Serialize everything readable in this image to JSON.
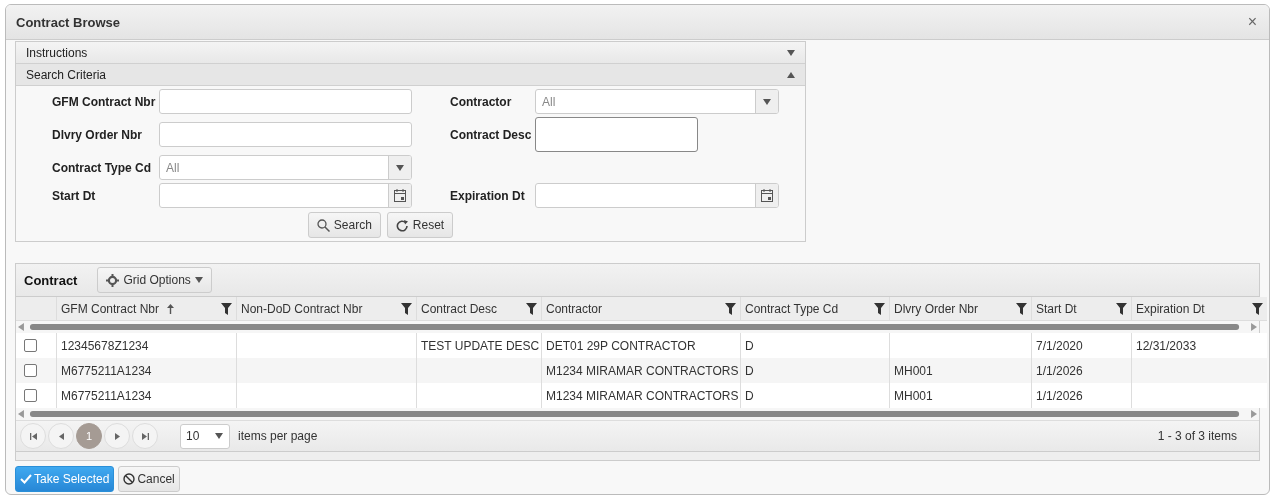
{
  "window": {
    "title": "Contract Browse",
    "close": "×"
  },
  "sections": [
    {
      "title": "Instructions",
      "expanded": false
    },
    {
      "title": "Search Criteria",
      "expanded": true
    }
  ],
  "form_rows": [
    {
      "left": {
        "label": "GFM Contract Nbr",
        "kind": "text"
      },
      "right": {
        "label": "Contractor",
        "kind": "select",
        "value": "All"
      }
    },
    {
      "left": {
        "label": "Dlvry Order Nbr",
        "kind": "text"
      },
      "right": {
        "label": "Contract Desc",
        "kind": "textarea"
      }
    },
    {
      "left": {
        "label": "Contract Type Cd",
        "kind": "select",
        "value": "All"
      }
    },
    {
      "left": {
        "label": "Start Dt",
        "kind": "date"
      },
      "right": {
        "label": "Expiration Dt",
        "kind": "date"
      }
    }
  ],
  "search_buttons": [
    {
      "label": "Search",
      "kind": "search"
    },
    {
      "label": "Reset",
      "kind": "reset"
    }
  ],
  "grid": {
    "title": "Contract",
    "options_label": "Grid Options",
    "columns": [
      {
        "label": "GFM Contract Nbr",
        "sorted": true
      },
      {
        "label": "Non-DoD Contract Nbr",
        "sorted": false
      },
      {
        "label": "Contract Desc",
        "sorted": false
      },
      {
        "label": "Contractor",
        "sorted": false
      },
      {
        "label": "Contract Type Cd",
        "sorted": false
      },
      {
        "label": "Dlvry Order Nbr",
        "sorted": false
      },
      {
        "label": "Start Dt",
        "sorted": false
      },
      {
        "label": "Expiration Dt",
        "sorted": false
      }
    ],
    "rows": [
      {
        "checked": false,
        "cells": [
          "12345678Z1234",
          "",
          "TEST UPDATE DESC",
          "DET01 29P CONTRACTOR",
          "D",
          "",
          "7/1/2020",
          "12/31/2033"
        ]
      },
      {
        "checked": false,
        "cells": [
          "M6775211A1234",
          "",
          "",
          "M1234 MIRAMAR CONTRACTORS",
          "D",
          "MH001",
          "1/1/2026",
          ""
        ]
      },
      {
        "checked": false,
        "cells": [
          "M6775211A1234",
          "",
          "",
          "M1234 MIRAMAR CONTRACTORS",
          "D",
          "MH001",
          "1/1/2026",
          ""
        ]
      }
    ],
    "pages": [
      {
        "label": "1",
        "selected": true
      }
    ],
    "page_size": "10",
    "page_size_label": "items per page",
    "summary": "1 - 3 of 3 items"
  },
  "actions": [
    {
      "label": "Take Selected",
      "kind": "primary"
    },
    {
      "label": "Cancel",
      "kind": "cancel"
    }
  ]
}
